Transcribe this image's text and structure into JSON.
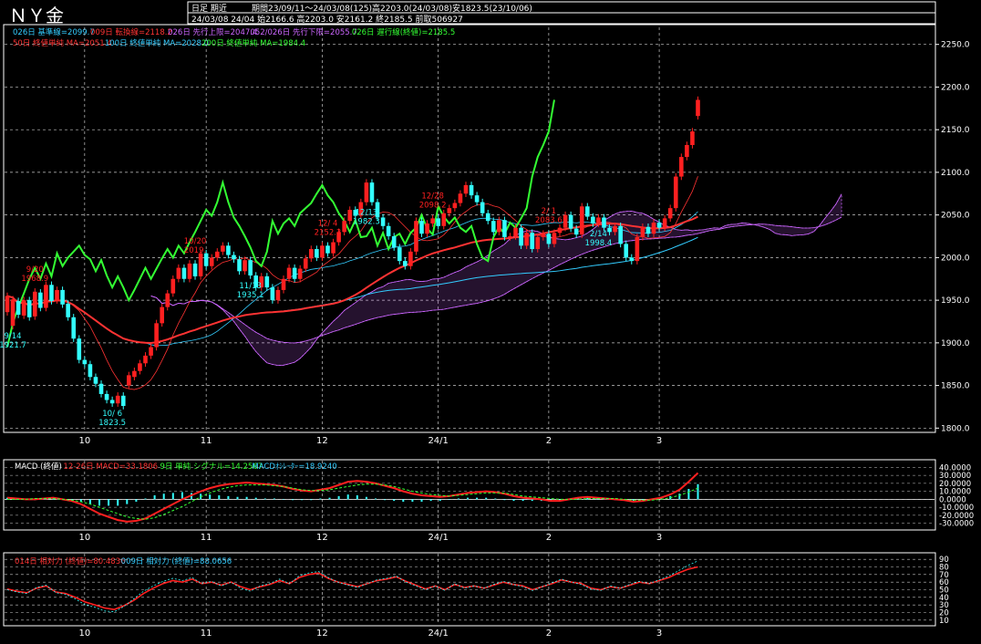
{
  "header": {
    "title": "ＮＹ金",
    "mode": "日足 期近",
    "period_line": "期間23/09/11～24/03/08(125)高2203.0(24/03/08)安1823.5(23/10/06)",
    "ohlc_line": "24/03/08 24/04 始2166.6 高2203.0 安2161.2 終2185.5 前取506927"
  },
  "legend1": [
    {
      "text": "026日 基準線=2099.7",
      "color": "#33ccff"
    },
    {
      "text": "009日 転換線=2118.2",
      "color": "#ff3333"
    },
    {
      "text": "026日 先行上限=2047.4",
      "color": "#cc66ff"
    },
    {
      "text": "052/026日 先行下限=2055.7",
      "color": "#cc66ff"
    },
    {
      "text": "026日 遅行線(終値)=2185.5",
      "color": "#33ff33"
    }
  ],
  "legend2": [
    {
      "text": "50日 終値単純 MA=2051.4",
      "color": "#ff3333"
    },
    {
      "text": "100日 終値単純 MA=2028.0",
      "color": "#33ccff"
    },
    {
      "text": "200日 終値単純 MA=1984.4",
      "color": "#33ff33"
    }
  ],
  "macd_legend": [
    {
      "text": "MACD (終値)",
      "color": "#ffffff"
    },
    {
      "text": "12-26日 MACD=33.1806",
      "color": "#ff3333"
    },
    {
      "text": "9日 単純 シグナル=14.2567",
      "color": "#33ff33"
    },
    {
      "text": "MACDｵｼﾚｰﾀｰ=18.9240",
      "color": "#33ccff"
    }
  ],
  "rsi_legend": [
    {
      "text": "014日 相対力 (終値)=80.4836",
      "color": "#ff3333"
    },
    {
      "text": "009日 相対力 (終値)=88.0656",
      "color": "#33ccff"
    }
  ],
  "colors": {
    "up": "#ff2020",
    "down": "#33ffff",
    "grid": "#c8c8c8",
    "frame": "#ffffff",
    "axis_text": "#ffffff",
    "kijun": "#33ccff",
    "tenkan": "#ff3333",
    "senkou": "#cc66ff",
    "chikou": "#33ff33",
    "ma50": "#ff3333",
    "ma100": "#33ccff",
    "ma200": "#33ff33"
  },
  "chart_data": [
    {
      "type": "candlestick",
      "name": "price",
      "ylim": [
        1795,
        2270
      ],
      "y_ticks": [
        1800,
        1850,
        1900,
        1950,
        2000,
        2050,
        2100,
        2150,
        2200,
        2250
      ],
      "x_ticks": [
        "10",
        "11",
        "12",
        "24/1",
        "2",
        "3"
      ],
      "points": [
        [
          1936,
          1955
        ],
        [
          1920,
          1951
        ],
        [
          1949,
          1933
        ],
        [
          1932,
          1950
        ],
        [
          1950,
          1930
        ],
        [
          1931,
          1960
        ],
        [
          1959,
          1941
        ],
        [
          1941,
          1968
        ],
        [
          1968,
          1949
        ],
        [
          1950,
          1962
        ],
        [
          1962,
          1945
        ],
        [
          1946,
          1930
        ],
        [
          1930,
          1905
        ],
        [
          1905,
          1880
        ],
        [
          1880,
          1875
        ],
        [
          1875,
          1860
        ],
        [
          1860,
          1852
        ],
        [
          1852,
          1840
        ],
        [
          1840,
          1833
        ],
        [
          1833,
          1829
        ],
        [
          1829,
          1838
        ],
        [
          1838,
          1826
        ],
        [
          1850,
          1862
        ],
        [
          1860,
          1867
        ],
        [
          1867,
          1876
        ],
        [
          1876,
          1885
        ],
        [
          1885,
          1895
        ],
        [
          1895,
          1923
        ],
        [
          1923,
          1942
        ],
        [
          1942,
          1958
        ],
        [
          1958,
          1975
        ],
        [
          1975,
          1988
        ],
        [
          1988,
          1975
        ],
        [
          1975,
          1993
        ],
        [
          1993,
          1978
        ],
        [
          1978,
          2005
        ],
        [
          2005,
          1990
        ],
        [
          1990,
          2000
        ],
        [
          2000,
          2007
        ],
        [
          2007,
          2014
        ],
        [
          2014,
          2003
        ],
        [
          2003,
          1998
        ],
        [
          1998,
          1984
        ],
        [
          1984,
          1997
        ],
        [
          1997,
          1979
        ],
        [
          1979,
          1965
        ],
        [
          1965,
          1978
        ],
        [
          1978,
          1965
        ],
        [
          1965,
          1950
        ],
        [
          1950,
          1962
        ],
        [
          1962,
          1975
        ],
        [
          1975,
          1988
        ],
        [
          1988,
          1975
        ],
        [
          1975,
          1987
        ],
        [
          1987,
          1999
        ],
        [
          1999,
          2010
        ],
        [
          2010,
          2000
        ],
        [
          2000,
          2014
        ],
        [
          2014,
          2005
        ],
        [
          2005,
          2018
        ],
        [
          2018,
          2030
        ],
        [
          2030,
          2043
        ],
        [
          2043,
          2056
        ],
        [
          2056,
          2049
        ],
        [
          2049,
          2065
        ],
        [
          2065,
          2088
        ],
        [
          2088,
          2065
        ],
        [
          2065,
          2047
        ],
        [
          2047,
          2037
        ],
        [
          2037,
          2025
        ],
        [
          2025,
          2012
        ],
        [
          2012,
          1996
        ],
        [
          1996,
          1990
        ],
        [
          1990,
          2007
        ],
        [
          2007,
          2043
        ],
        [
          2043,
          2028
        ],
        [
          2028,
          2040
        ],
        [
          2040,
          2046
        ],
        [
          2046,
          2037
        ],
        [
          2037,
          2052
        ],
        [
          2052,
          2058
        ],
        [
          2058,
          2064
        ],
        [
          2064,
          2075
        ],
        [
          2075,
          2085
        ],
        [
          2085,
          2073
        ],
        [
          2073,
          2065
        ],
        [
          2065,
          2052
        ],
        [
          2052,
          2043
        ],
        [
          2043,
          2030
        ],
        [
          2030,
          2044
        ],
        [
          2044,
          2024
        ],
        [
          2024,
          2025
        ],
        [
          2025,
          2035
        ],
        [
          2035,
          2014
        ],
        [
          2014,
          2029
        ],
        [
          2029,
          2010
        ],
        [
          2010,
          2024
        ],
        [
          2024,
          2028
        ],
        [
          2028,
          2016
        ],
        [
          2016,
          2029
        ],
        [
          2029,
          2035
        ],
        [
          2035,
          2050
        ],
        [
          2050,
          2034
        ],
        [
          2034,
          2027
        ],
        [
          2027,
          2060
        ],
        [
          2060,
          2048
        ],
        [
          2048,
          2040
        ],
        [
          2040,
          2047
        ],
        [
          2047,
          2035
        ],
        [
          2035,
          2030
        ],
        [
          2030,
          2037
        ],
        [
          2037,
          2016
        ],
        [
          2016,
          2000
        ],
        [
          2000,
          1996
        ],
        [
          1996,
          2024
        ],
        [
          2024,
          2036
        ],
        [
          2036,
          2028
        ],
        [
          2028,
          2041
        ],
        [
          2041,
          2035
        ],
        [
          2035,
          2046
        ],
        [
          2046,
          2058
        ],
        [
          2058,
          2095
        ],
        [
          2095,
          2118
        ],
        [
          2118,
          2132
        ],
        [
          2132,
          2148
        ],
        [
          2166,
          2185
        ]
      ],
      "annotations": [
        {
          "date": "9/14",
          "value": "1921.7",
          "kind": "low"
        },
        {
          "date": "9/20",
          "value": "1968.9",
          "kind": "high"
        },
        {
          "date": "10/ 6",
          "value": "1823.5",
          "kind": "low"
        },
        {
          "date": "10/20",
          "value": "2019.",
          "kind": "high"
        },
        {
          "date": "11/13",
          "value": "1935.1",
          "kind": "low"
        },
        {
          "date": "12/ 4",
          "value": "2152.3",
          "kind": "high"
        },
        {
          "date": "12/13",
          "value": "1982.3",
          "kind": "low"
        },
        {
          "date": "12/28",
          "value": "2098.2",
          "kind": "high"
        },
        {
          "date": "2/ 1",
          "value": "2083.6",
          "kind": "high"
        },
        {
          "date": "2/14",
          "value": "1998.4",
          "kind": "low"
        }
      ]
    },
    {
      "type": "line",
      "name": "macd",
      "ylim": [
        -35,
        45
      ],
      "y_ticks": [
        -30,
        -20,
        -10,
        0,
        10,
        20,
        30,
        40
      ],
      "y_tick_labels": [
        "-30.0000",
        "-20.0000",
        "-10.0000",
        "0.0000",
        "10.0000",
        "20.0000",
        "30.0000",
        "40.0000"
      ],
      "series": [
        {
          "name": "12-26日 MACD",
          "values": [
            2,
            1,
            0,
            0,
            1,
            2,
            0,
            -2,
            -6,
            -12,
            -18,
            -22,
            -26,
            -28,
            -27,
            -24,
            -18,
            -12,
            -6,
            0,
            5,
            10,
            14,
            17,
            19,
            20,
            21,
            20,
            19,
            18,
            16,
            13,
            11,
            10,
            12,
            14,
            18,
            22,
            23,
            22,
            20,
            17,
            14,
            10,
            7,
            5,
            4,
            3,
            4,
            6,
            8,
            9,
            10,
            9,
            7,
            4,
            2,
            1,
            0,
            -2,
            -2,
            0,
            2,
            3,
            2,
            1,
            0,
            -1,
            -3,
            -2,
            0,
            2,
            6,
            12,
            22,
            33
          ]
        },
        {
          "name": "9日 単純 シグナル",
          "values": [
            0,
            0,
            0,
            1,
            1,
            1,
            0,
            -1,
            -3,
            -6,
            -10,
            -14,
            -18,
            -22,
            -24,
            -25,
            -23,
            -19,
            -14,
            -9,
            -3,
            3,
            8,
            12,
            15,
            17,
            18,
            18,
            18,
            17,
            16,
            14,
            12,
            11,
            11,
            12,
            14,
            16,
            18,
            19,
            19,
            18,
            16,
            13,
            10,
            8,
            6,
            5,
            4,
            5,
            6,
            7,
            8,
            8,
            8,
            6,
            4,
            3,
            2,
            1,
            0,
            0,
            0,
            1,
            1,
            1,
            1,
            0,
            -1,
            -1,
            -1,
            0,
            2,
            5,
            9,
            14
          ]
        }
      ],
      "histogram": [
        2,
        1,
        0,
        -1,
        0,
        1,
        0,
        -1,
        -3,
        -6,
        -8,
        -8,
        -8,
        -6,
        -3,
        1,
        5,
        7,
        8,
        9,
        8,
        7,
        6,
        5,
        4,
        3,
        3,
        2,
        1,
        1,
        0,
        -1,
        -1,
        -1,
        1,
        2,
        4,
        6,
        5,
        3,
        1,
        -1,
        -2,
        -3,
        -3,
        -3,
        -2,
        -2,
        0,
        1,
        2,
        2,
        2,
        1,
        -1,
        -2,
        -2,
        -2,
        -2,
        -3,
        -2,
        0,
        2,
        2,
        1,
        0,
        -1,
        -1,
        -2,
        -1,
        1,
        2,
        4,
        7,
        13,
        19
      ]
    },
    {
      "type": "line",
      "name": "rsi",
      "ylim": [
        5,
        95
      ],
      "y_ticks": [
        10,
        20,
        30,
        40,
        50,
        60,
        70,
        80,
        90
      ],
      "series": [
        {
          "name": "014日 相対力 (終値)",
          "values": [
            51,
            48,
            46,
            52,
            55,
            47,
            45,
            40,
            34,
            30,
            26,
            24,
            29,
            36,
            45,
            52,
            58,
            62,
            60,
            64,
            58,
            60,
            56,
            60,
            54,
            50,
            54,
            57,
            62,
            58,
            66,
            70,
            72,
            65,
            60,
            57,
            54,
            58,
            62,
            64,
            67,
            61,
            56,
            51,
            55,
            50,
            57,
            53,
            55,
            52,
            56,
            60,
            57,
            55,
            50,
            54,
            58,
            63,
            60,
            58,
            52,
            50,
            54,
            52,
            56,
            60,
            58,
            62,
            66,
            72,
            77,
            80
          ]
        },
        {
          "name": "009日 相対力 (終値)",
          "values": [
            50,
            47,
            45,
            53,
            56,
            46,
            44,
            38,
            30,
            27,
            22,
            21,
            28,
            38,
            48,
            55,
            61,
            65,
            62,
            66,
            58,
            61,
            55,
            60,
            52,
            48,
            55,
            58,
            64,
            58,
            68,
            72,
            74,
            66,
            60,
            56,
            53,
            58,
            63,
            65,
            68,
            60,
            55,
            50,
            55,
            49,
            58,
            52,
            55,
            52,
            57,
            61,
            57,
            54,
            49,
            54,
            59,
            64,
            60,
            57,
            51,
            49,
            55,
            52,
            57,
            61,
            58,
            63,
            68,
            75,
            82,
            88
          ]
        }
      ]
    }
  ]
}
